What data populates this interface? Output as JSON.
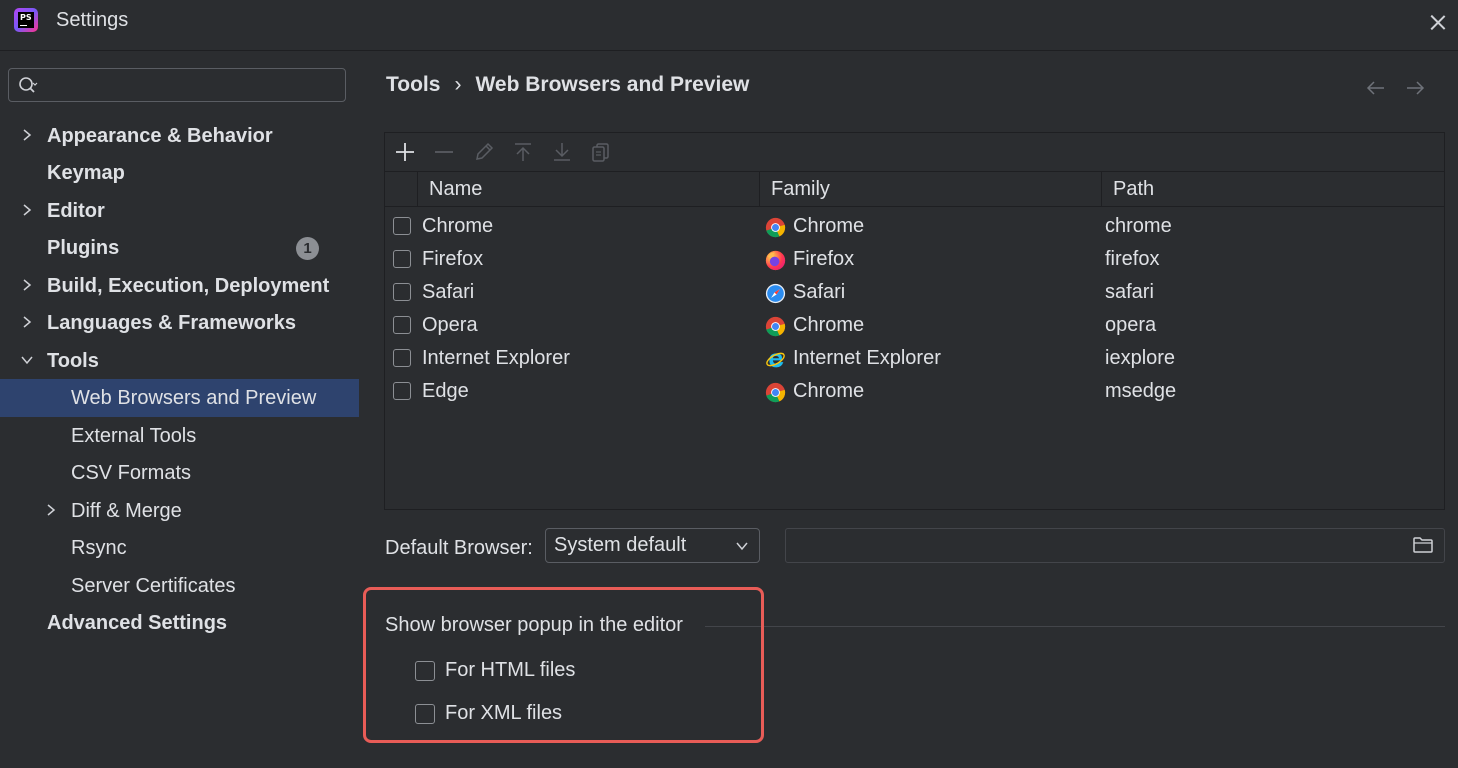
{
  "window": {
    "title": "Settings"
  },
  "search": {
    "value": "",
    "placeholder": ""
  },
  "sidebar": {
    "items": [
      {
        "label": "Appearance & Behavior",
        "expandable": true,
        "expanded": false
      },
      {
        "label": "Keymap",
        "expandable": false
      },
      {
        "label": "Editor",
        "expandable": true,
        "expanded": false
      },
      {
        "label": "Plugins",
        "expandable": false,
        "badge": "1"
      },
      {
        "label": "Build, Execution, Deployment",
        "expandable": true,
        "expanded": false
      },
      {
        "label": "Languages & Frameworks",
        "expandable": true,
        "expanded": false
      },
      {
        "label": "Tools",
        "expandable": true,
        "expanded": true
      },
      {
        "label": "Web Browsers and Preview",
        "selected": true
      },
      {
        "label": "External Tools"
      },
      {
        "label": "CSV Formats"
      },
      {
        "label": "Diff & Merge",
        "expandable": true,
        "expanded": false
      },
      {
        "label": "Rsync"
      },
      {
        "label": "Server Certificates"
      },
      {
        "label": "Advanced Settings",
        "expandable": false
      }
    ]
  },
  "breadcrumb": {
    "parent": "Tools",
    "separator": "›",
    "current": "Web Browsers and Preview"
  },
  "table": {
    "columns": [
      "Name",
      "Family",
      "Path"
    ],
    "rows": [
      {
        "name": "Chrome",
        "family": "Chrome",
        "family_icon": "chrome-icon",
        "path": "chrome",
        "checked": false
      },
      {
        "name": "Firefox",
        "family": "Firefox",
        "family_icon": "firefox-icon",
        "path": "firefox",
        "checked": false
      },
      {
        "name": "Safari",
        "family": "Safari",
        "family_icon": "safari-icon",
        "path": "safari",
        "checked": false
      },
      {
        "name": "Opera",
        "family": "Chrome",
        "family_icon": "chrome-icon",
        "path": "opera",
        "checked": false
      },
      {
        "name": "Internet Explorer",
        "family": "Internet Explorer",
        "family_icon": "internet-explorer-icon",
        "path": "iexplore",
        "checked": false
      },
      {
        "name": "Edge",
        "family": "Chrome",
        "family_icon": "chrome-icon",
        "path": "msedge",
        "checked": false
      }
    ]
  },
  "default_browser": {
    "label": "Default Browser:",
    "value": "System default",
    "path_value": ""
  },
  "popup_group": {
    "title": "Show browser popup in the editor",
    "options": [
      {
        "label": "For HTML files",
        "checked": false
      },
      {
        "label": "For XML files",
        "checked": false
      }
    ]
  },
  "colors": {
    "background": "#2b2d30",
    "selection": "#2e436e",
    "highlight_border": "#e85c57",
    "text": "#dfe1e5"
  }
}
